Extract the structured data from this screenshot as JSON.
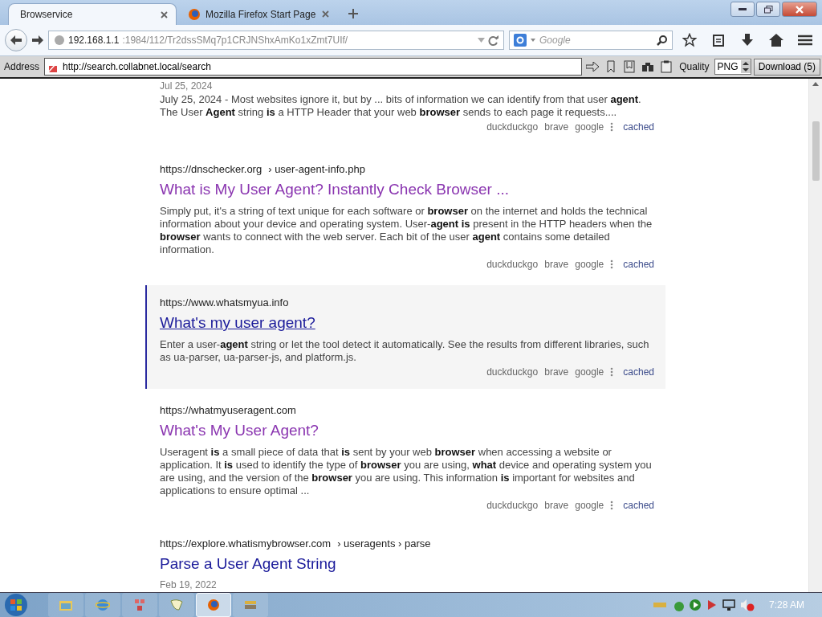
{
  "tabs": [
    {
      "label": "Browservice",
      "selected": true,
      "kind": "plain"
    },
    {
      "label": "Mozilla Firefox Start Page",
      "selected": false,
      "kind": "firefox"
    }
  ],
  "url_bar": {
    "host": "192.168.1.1",
    "path": ":1984/112/Tr2dssSMq7p1CRJNShxAmKo1xZmt7UIf/"
  },
  "search_field": {
    "placeholder": "Google"
  },
  "toolbar": {
    "address_label": "Address",
    "address": "http://search.collabnet.local/search",
    "quality_label": "Quality",
    "quality": "PNG",
    "download": "Download (5)"
  },
  "results": [
    {
      "date": "Jul 25, 2024",
      "snippet": "July 25, 2024 - Most websites ignore it, but by ... bits of information we can identify from that user **agent**. The User **Agent** string **is** a HTTP Header that your web **browser** sends to each page it requests....",
      "engines": [
        "duckduckgo",
        "brave",
        "google"
      ],
      "cached": "cached"
    },
    {
      "url": "https://dnschecker.org",
      "path": "› user-agent-info.php",
      "title": "What is My User Agent? Instantly Check Browser ...",
      "visited": true,
      "highlighted": false,
      "snippet": "Simply put, it's a string of text unique for each software or **browser** on the internet and holds the technical information about your device and operating system. User-**agent is** present in the HTTP headers when the **browser** wants to connect with the web server. Each bit of the user **agent** contains some detailed information.",
      "engines": [
        "duckduckgo",
        "brave",
        "google"
      ],
      "cached": "cached"
    },
    {
      "url": "https://www.whatsmyua.info",
      "title": "What's my user agent?",
      "visited": false,
      "highlighted": true,
      "snippet": "Enter a user-**agent** string or let the tool detect it automatically. See the results from different libraries, such as ua-parser, ua-parser-js, and platform.js.",
      "engines": [
        "duckduckgo",
        "brave",
        "google"
      ],
      "cached": "cached"
    },
    {
      "url": "https://whatmyuseragent.com",
      "title": "What's My User Agent?",
      "visited": true,
      "highlighted": false,
      "snippet": "Useragent **is** a small piece of data that **is** sent by your web **browser** when accessing a website or application. It **is** used to identify the type of **browser** you are using, **what** device and operating system you are using, and the version of the **browser** you are using. This information **is** important for websites and applications to ensure optimal ...",
      "engines": [
        "duckduckgo",
        "brave",
        "google"
      ],
      "cached": "cached"
    },
    {
      "url": "https://explore.whatismybrowser.com",
      "path": "› useragents › parse",
      "title": "Parse a User Agent String",
      "visited": false,
      "highlighted": false,
      "date": "Feb 19, 2022"
    }
  ],
  "taskbar": {
    "apps": [
      {
        "kind": "folder",
        "selected": false
      },
      {
        "kind": "ie",
        "selected": false
      },
      {
        "kind": "network",
        "selected": false
      },
      {
        "kind": "paint",
        "selected": false
      },
      {
        "kind": "firefox",
        "selected": true
      },
      {
        "kind": "archive",
        "selected": false
      }
    ],
    "clock": "7:28 AM"
  }
}
